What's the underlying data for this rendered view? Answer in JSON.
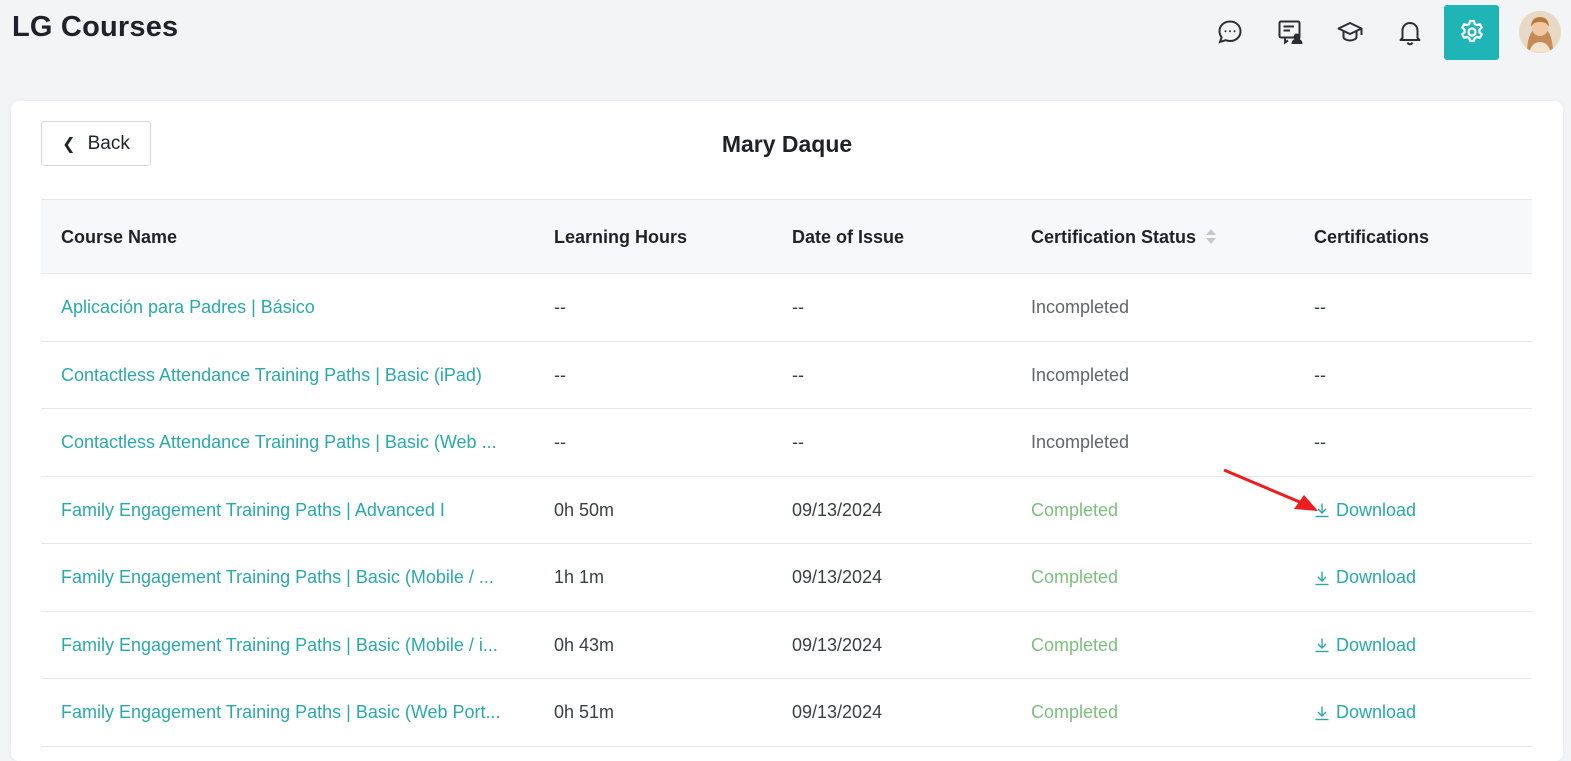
{
  "app": {
    "title": "LG Courses"
  },
  "header": {
    "icons": [
      "chat-icon",
      "teacher-board-icon",
      "graduation-cap-icon",
      "bell-icon",
      "gear-icon"
    ]
  },
  "page": {
    "back_label": "Back",
    "student_name": "Mary Daque"
  },
  "table": {
    "columns": [
      "Course Name",
      "Learning Hours",
      "Date of Issue",
      "Certification Status",
      "Certifications"
    ],
    "rows": [
      {
        "course": "Aplicación para Padres | Básico",
        "hours": "--",
        "date": "--",
        "status": "Incompleted",
        "cert": "--"
      },
      {
        "course": "Contactless Attendance Training Paths | Basic (iPad)",
        "hours": "--",
        "date": "--",
        "status": "Incompleted",
        "cert": "--"
      },
      {
        "course": "Contactless Attendance Training Paths | Basic (Web ...",
        "hours": "--",
        "date": "--",
        "status": "Incompleted",
        "cert": "--"
      },
      {
        "course": "Family Engagement Training Paths | Advanced I",
        "hours": "0h 50m",
        "date": "09/13/2024",
        "status": "Completed",
        "cert": "Download"
      },
      {
        "course": "Family Engagement Training Paths | Basic (Mobile / ...",
        "hours": "1h 1m",
        "date": "09/13/2024",
        "status": "Completed",
        "cert": "Download"
      },
      {
        "course": "Family Engagement Training Paths | Basic (Mobile / i...",
        "hours": "0h 43m",
        "date": "09/13/2024",
        "status": "Completed",
        "cert": "Download"
      },
      {
        "course": "Family Engagement Training Paths | Basic (Web Port...",
        "hours": "0h 51m",
        "date": "09/13/2024",
        "status": "Completed",
        "cert": "Download"
      }
    ]
  },
  "colors": {
    "accent": "#1fb5b7",
    "link": "#2aa9ad",
    "completed": "#7cc07c",
    "annotation_arrow": "#ee1c1c"
  }
}
